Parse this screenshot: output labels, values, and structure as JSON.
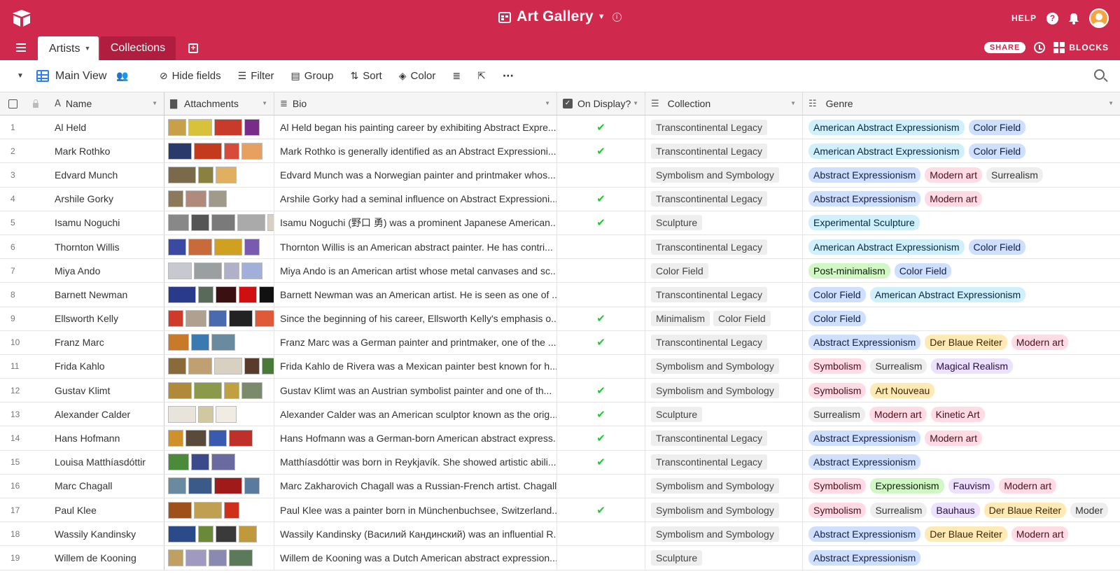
{
  "header": {
    "base_title": "Art Gallery",
    "help_label": "HELP",
    "help_glyph": "?",
    "brand_color": "#cf2a4e"
  },
  "tabs": {
    "active": "Artists",
    "inactive": "Collections",
    "share_label": "SHARE",
    "blocks_label": "BLOCKS"
  },
  "viewbar": {
    "view_name": "Main View",
    "hide_fields": "Hide fields",
    "filter": "Filter",
    "group": "Group",
    "sort": "Sort",
    "color": "Color"
  },
  "columns": {
    "name": "Name",
    "attachments": "Attachments",
    "bio": "Bio",
    "on_display": "On Display?",
    "collection": "Collection",
    "genre": "Genre"
  },
  "genre_colors": {
    "American Abstract Expressionism": "g-teal",
    "Color Field": "g-blue",
    "Abstract Expressionism": "g-blue",
    "Modern art": "g-red",
    "Surrealism": "g-gray",
    "Experimental Sculpture": "g-teal",
    "Post-minimalism": "g-green",
    "Der Blaue Reiter": "g-yellow",
    "Symbolism": "g-red",
    "Magical Realism": "g-purple",
    "Art Nouveau": "g-yellow",
    "Kinetic Art": "g-red",
    "Expressionism": "g-green",
    "Fauvism": "g-purple",
    "Bauhaus": "g-purple",
    "Moder": "g-gray"
  },
  "rows": [
    {
      "num": "1",
      "name": "Al Held",
      "thumbs": [
        "#c8a04a",
        "#d8c23c",
        "#c83a2a",
        "#7a2c8a"
      ],
      "bio": "Al Held began his painting career by exhibiting Abstract Expre...",
      "on_display": true,
      "collection": [
        "Transcontinental Legacy"
      ],
      "genre": [
        "American Abstract Expressionism",
        "Color Field"
      ]
    },
    {
      "num": "2",
      "name": "Mark Rothko",
      "thumbs": [
        "#2a3a6a",
        "#c33a1e",
        "#d84a3a",
        "#e8a060"
      ],
      "bio": "Mark Rothko is generally identified as an Abstract Expressioni...",
      "on_display": true,
      "collection": [
        "Transcontinental Legacy"
      ],
      "genre": [
        "American Abstract Expressionism",
        "Color Field"
      ]
    },
    {
      "num": "3",
      "name": "Edvard Munch",
      "thumbs": [
        "#7a6a4a",
        "#8a8040",
        "#e0b060"
      ],
      "bio": "Edvard Munch was a Norwegian painter and printmaker whos...",
      "on_display": false,
      "collection": [
        "Symbolism and Symbology"
      ],
      "genre": [
        "Abstract Expressionism",
        "Modern art",
        "Surrealism"
      ]
    },
    {
      "num": "4",
      "name": "Arshile Gorky",
      "thumbs": [
        "#8a7a5a",
        "#b08a7a",
        "#a09a8a"
      ],
      "bio": "Arshile Gorky had a seminal influence on Abstract Expressioni...",
      "on_display": true,
      "collection": [
        "Transcontinental Legacy"
      ],
      "genre": [
        "Abstract Expressionism",
        "Modern art"
      ]
    },
    {
      "num": "5",
      "name": "Isamu Noguchi",
      "thumbs": [
        "#888888",
        "#555555",
        "#7a7a7a",
        "#aaaaaa",
        "#d8d0c0"
      ],
      "bio": "Isamu Noguchi (野口 勇) was a prominent Japanese American...",
      "on_display": true,
      "collection": [
        "Sculpture"
      ],
      "genre": [
        "Experimental Sculpture"
      ]
    },
    {
      "num": "6",
      "name": "Thornton Willis",
      "thumbs": [
        "#3a4aa0",
        "#c86a3a",
        "#d0a020",
        "#7a5ab0"
      ],
      "bio": "Thornton Willis is an American abstract painter. He has contri...",
      "on_display": false,
      "collection": [
        "Transcontinental Legacy"
      ],
      "genre": [
        "American Abstract Expressionism",
        "Color Field"
      ]
    },
    {
      "num": "7",
      "name": "Miya Ando",
      "thumbs": [
        "#c8c8d0",
        "#9aa0a0",
        "#b0b0c8",
        "#a0b0d8"
      ],
      "bio": "Miya Ando is an American artist whose metal canvases and sc...",
      "on_display": false,
      "collection": [
        "Color Field"
      ],
      "genre": [
        "Post-minimalism",
        "Color Field"
      ]
    },
    {
      "num": "8",
      "name": "Barnett Newman",
      "thumbs": [
        "#2a3a8a",
        "#5a6a5a",
        "#3a1010",
        "#d01010",
        "#111111"
      ],
      "bio": "Barnett Newman was an American artist. He is seen as one of ...",
      "on_display": false,
      "collection": [
        "Transcontinental Legacy"
      ],
      "genre": [
        "Color Field",
        "American Abstract Expressionism"
      ]
    },
    {
      "num": "9",
      "name": "Ellsworth Kelly",
      "thumbs": [
        "#d03a2a",
        "#b0a090",
        "#4a6ab0",
        "#222222",
        "#e05a3a"
      ],
      "bio": "Since the beginning of his career, Ellsworth Kelly's emphasis o...",
      "on_display": true,
      "collection": [
        "Minimalism",
        "Color Field"
      ],
      "genre": [
        "Color Field"
      ]
    },
    {
      "num": "10",
      "name": "Franz Marc",
      "thumbs": [
        "#c87a2a",
        "#3a7ab0",
        "#6a8aa0"
      ],
      "bio": "Franz Marc was a German painter and printmaker, one of the ...",
      "on_display": true,
      "collection": [
        "Transcontinental Legacy"
      ],
      "genre": [
        "Abstract Expressionism",
        "Der Blaue Reiter",
        "Modern art"
      ]
    },
    {
      "num": "11",
      "name": "Frida Kahlo",
      "thumbs": [
        "#8a6a3a",
        "#c0a070",
        "#d8d0c0",
        "#5a3a2a",
        "#4a7a3a"
      ],
      "bio": "Frida Kahlo de Rivera was a Mexican painter best known for h...",
      "on_display": false,
      "collection": [
        "Symbolism and Symbology"
      ],
      "genre": [
        "Symbolism",
        "Surrealism",
        "Magical Realism"
      ]
    },
    {
      "num": "12",
      "name": "Gustav Klimt",
      "thumbs": [
        "#b08a3a",
        "#8a9a4a",
        "#c0a040",
        "#7a8a6a"
      ],
      "bio": "Gustav Klimt was an Austrian symbolist painter and one of th...",
      "on_display": true,
      "collection": [
        "Symbolism and Symbology"
      ],
      "genre": [
        "Symbolism",
        "Art Nouveau"
      ]
    },
    {
      "num": "13",
      "name": "Alexander Calder",
      "thumbs": [
        "#e8e4dc",
        "#d0c8a0",
        "#f0ece4"
      ],
      "bio": "Alexander Calder was an American sculptor known as the orig...",
      "on_display": true,
      "collection": [
        "Sculpture"
      ],
      "genre": [
        "Surrealism",
        "Modern art",
        "Kinetic Art"
      ]
    },
    {
      "num": "14",
      "name": "Hans Hofmann",
      "thumbs": [
        "#d0902a",
        "#5a4a3a",
        "#3a5ab0",
        "#c0302a"
      ],
      "bio": "Hans Hofmann was a German-born American abstract express...",
      "on_display": true,
      "collection": [
        "Transcontinental Legacy"
      ],
      "genre": [
        "Abstract Expressionism",
        "Modern art"
      ]
    },
    {
      "num": "15",
      "name": "Louisa Matthíasdóttir",
      "thumbs": [
        "#4a8a3a",
        "#3a4a8a",
        "#6a6aa0"
      ],
      "bio": "Matthíasdóttir was born in Reykjavík. She showed artistic abili...",
      "on_display": true,
      "collection": [
        "Transcontinental Legacy"
      ],
      "genre": [
        "Abstract Expressionism"
      ]
    },
    {
      "num": "16",
      "name": "Marc Chagall",
      "thumbs": [
        "#6a8aa0",
        "#3a5a8a",
        "#a01a1a",
        "#5a7aa0"
      ],
      "bio": "Marc Zakharovich Chagall was a Russian-French artist. Chagall...",
      "on_display": false,
      "collection": [
        "Symbolism and Symbology"
      ],
      "genre": [
        "Symbolism",
        "Expressionism",
        "Fauvism",
        "Modern art"
      ]
    },
    {
      "num": "17",
      "name": "Paul Klee",
      "thumbs": [
        "#a0501a",
        "#c0a050",
        "#d0301a"
      ],
      "bio": "Paul Klee was a painter born in Münchenbuchsee, Switzerland...",
      "on_display": true,
      "collection": [
        "Symbolism and Symbology"
      ],
      "genre": [
        "Symbolism",
        "Surrealism",
        "Bauhaus",
        "Der Blaue Reiter",
        "Moder"
      ]
    },
    {
      "num": "18",
      "name": "Wassily Kandinsky",
      "thumbs": [
        "#2a4a8a",
        "#6a8a3a",
        "#3a3a3a",
        "#c09a3a"
      ],
      "bio": "Wassily Kandinsky (Василий Кандинский) was an influential R...",
      "on_display": false,
      "collection": [
        "Symbolism and Symbology"
      ],
      "genre": [
        "Abstract Expressionism",
        "Der Blaue Reiter",
        "Modern art"
      ]
    },
    {
      "num": "19",
      "name": "Willem de Kooning",
      "thumbs": [
        "#c0a060",
        "#a09ac0",
        "#8a8ab0",
        "#5a7a5a"
      ],
      "bio": "Willem de Kooning was a Dutch American abstract expression...",
      "on_display": false,
      "collection": [
        "Sculpture"
      ],
      "genre": [
        "Abstract Expressionism"
      ]
    }
  ]
}
